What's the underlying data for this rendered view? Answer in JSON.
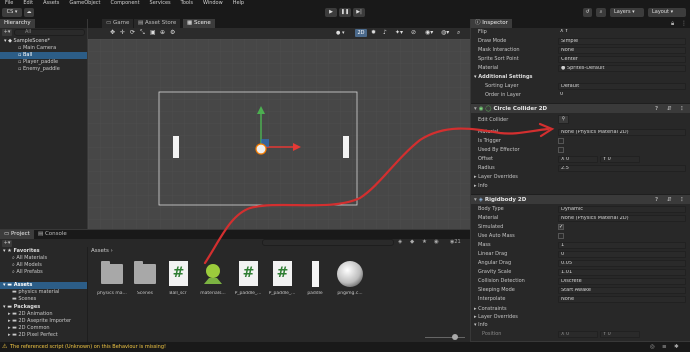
{
  "menubar": [
    "File",
    "Edit",
    "Assets",
    "GameObject",
    "Component",
    "Services",
    "Tools",
    "Window",
    "Help"
  ],
  "toolbar": {
    "account": "CS",
    "play": "▶",
    "pause": "❚❚",
    "step": "▶|",
    "layers": "Layers",
    "layout": "Layout"
  },
  "hierarchy": {
    "tab": "Hierarchy",
    "search_placeholder": "All",
    "items": [
      "SampleScene*",
      "Main Camera",
      "Ball",
      "Player_paddle",
      "Enemy_paddle"
    ]
  },
  "scene": {
    "tabs": [
      "Game",
      "Asset Store",
      "Scene"
    ],
    "mode_2d": "2D"
  },
  "inspector": {
    "tab": "Inspector",
    "renderer_rows": [
      {
        "label": "Flip",
        "value": "X   Y"
      },
      {
        "label": "Draw Mode",
        "value": "Simple"
      },
      {
        "label": "Mask Interaction",
        "value": "None"
      },
      {
        "label": "Sprite Sort Point",
        "value": "Center"
      },
      {
        "label": "Material",
        "value": "Sprites-Default"
      }
    ],
    "additional_settings": "Additional Settings",
    "additional_rows": [
      {
        "label": "Sorting Layer",
        "value": "Default"
      },
      {
        "label": "Order in Layer",
        "value": "0"
      }
    ],
    "circle_collider": {
      "title": "Circle Collider 2D",
      "edit_collider": "Edit Collider",
      "material_label": "Material",
      "material_value": "None (Physics Material 2D)",
      "is_trigger": "Is Trigger",
      "used_by_effector": "Used By Effector",
      "offset": "Offset",
      "offset_x": "0",
      "offset_y": "0",
      "radius": "Radius",
      "radius_value": "2.5",
      "layer_overrides": "Layer Overrides",
      "info": "Info"
    },
    "rigidbody": {
      "title": "Rigidbody 2D",
      "rows": [
        {
          "label": "Body Type",
          "value": "Dynamic"
        },
        {
          "label": "Material",
          "value": "None (Physics Material 2D)"
        },
        {
          "label": "Simulated",
          "value": ""
        },
        {
          "label": "Use Auto Mass",
          "value": ""
        },
        {
          "label": "Mass",
          "value": "1"
        },
        {
          "label": "Linear Drag",
          "value": "0"
        },
        {
          "label": "Angular Drag",
          "value": "0.05"
        },
        {
          "label": "Gravity Scale",
          "value": "1.01"
        },
        {
          "label": "Collision Detection",
          "value": "Discrete"
        },
        {
          "label": "Sleeping Mode",
          "value": "Start Awake"
        },
        {
          "label": "Interpolate",
          "value": "None"
        }
      ],
      "constraints": "Constraints",
      "layer_overrides": "Layer Overrides",
      "info": "Info",
      "position": "Position",
      "pos_x": "0",
      "pos_y": "0"
    }
  },
  "project": {
    "tabs": [
      "Project",
      "Console"
    ],
    "favorites": "Favorites",
    "fav_items": [
      "All Materials",
      "All Models",
      "All Prefabs"
    ],
    "assets": "Assets",
    "asset_folders": [
      "physics material",
      "Scenes"
    ],
    "packages": "Packages",
    "packages_items": [
      "2D Animation",
      "2D Aseprite Importer",
      "2D Common",
      "2D Pixel Perfect"
    ],
    "breadcrumb": "Assets",
    "badge_count": "21",
    "asset_items": [
      {
        "name": "physics ma...",
        "kind": "folder"
      },
      {
        "name": "Scenes",
        "kind": "folder"
      },
      {
        "name": "Ball_scr",
        "kind": "script"
      },
      {
        "name": "materials...",
        "kind": "material"
      },
      {
        "name": "P_paddle_...",
        "kind": "script"
      },
      {
        "name": "P_paddle_...",
        "kind": "script"
      },
      {
        "name": "paddle",
        "kind": "sprite"
      },
      {
        "name": "pngimg.c...",
        "kind": "sphere"
      }
    ]
  },
  "status_bar": {
    "message": "The referenced script (Unknown) on this Behaviour is missing!"
  }
}
